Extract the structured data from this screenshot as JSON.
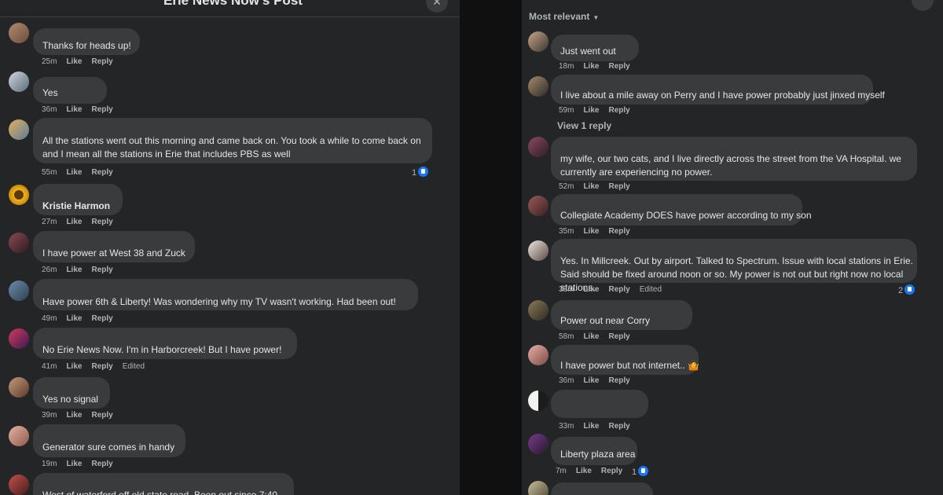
{
  "left_panel": {
    "title": "Erie News Now's Post",
    "close_glyph": "✕",
    "comments": [
      {
        "text": "Thanks for heads up!",
        "time": "25m",
        "like": "Like",
        "reply": "Reply"
      },
      {
        "text": "Yes",
        "time": "36m",
        "like": "Like",
        "reply": "Reply"
      },
      {
        "text": "All the stations went out this morning and came back on. You took a while to come back on and I mean all the stations in Erie that includes PBS as well",
        "time": "55m",
        "like": "Like",
        "reply": "Reply",
        "reactions": "1"
      },
      {
        "name": "Kristie Harmon",
        "text": "",
        "time": "27m",
        "like": "Like",
        "reply": "Reply"
      },
      {
        "text": "I have power at West 38 and Zuck",
        "time": "26m",
        "like": "Like",
        "reply": "Reply"
      },
      {
        "text": "Have power 6th & Liberty! Was wondering why my TV wasn't working. Had been out!",
        "time": "49m",
        "like": "Like",
        "reply": "Reply"
      },
      {
        "text": "No Erie News Now. I'm in Harborcreek! But I have power!",
        "time": "41m",
        "like": "Like",
        "reply": "Reply",
        "edited": "Edited"
      },
      {
        "text": "Yes no signal",
        "time": "39m",
        "like": "Like",
        "reply": "Reply"
      },
      {
        "text": "Generator sure comes in handy",
        "time": "19m",
        "like": "Like",
        "reply": "Reply"
      },
      {
        "text": "West of waterford off old state road. Been out since 7:40",
        "time": "",
        "like": "",
        "reply": ""
      }
    ]
  },
  "right_panel": {
    "sort_label": "Most relevant",
    "comments": [
      {
        "text": "Just went out",
        "time": "18m",
        "like": "Like",
        "reply": "Reply"
      },
      {
        "text": "I live about a mile away on Perry and I have power probably just jinxed myself",
        "time": "59m",
        "like": "Like",
        "reply": "Reply",
        "view_replies": "View 1 reply"
      },
      {
        "text": "my wife, our two cats, and I live directly across the street from the VA Hospital. we currently are experiencing no power.",
        "time": "52m",
        "like": "Like",
        "reply": "Reply"
      },
      {
        "text": "Collegiate Academy DOES have power according to my son",
        "time": "35m",
        "like": "Like",
        "reply": "Reply"
      },
      {
        "text": "Yes. In Millcreek. Out by airport. Talked to Spectrum. Issue with local stations in Erie. Said should be fixed around noon or so. My power is not out but right now no local stations.",
        "time": "38m",
        "like": "Like",
        "reply": "Reply",
        "edited": "Edited",
        "reactions": "2"
      },
      {
        "text": "Power out near Corry",
        "time": "58m",
        "like": "Like",
        "reply": "Reply"
      },
      {
        "text": "I have power but not internet.. 🤷",
        "time": "36m",
        "like": "Like",
        "reply": "Reply"
      },
      {
        "text": "",
        "time": "33m",
        "like": "Like",
        "reply": "Reply"
      },
      {
        "text": "Liberty plaza area",
        "time": "7m",
        "like": "Like",
        "reply": "Reply",
        "reactions": "1"
      }
    ]
  },
  "colors": {
    "panel_bg": "#242526",
    "bubble_bg": "#3a3b3c",
    "like_blue": "#1877f2",
    "muted_text": "#b0b3b8"
  }
}
